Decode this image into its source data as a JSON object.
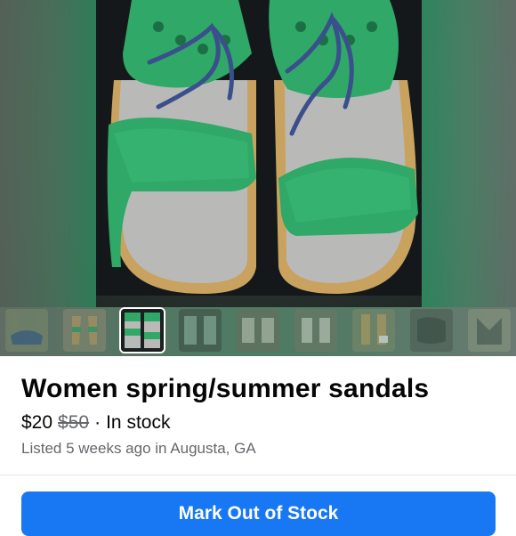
{
  "listing": {
    "title": "Women spring/summer sandals",
    "price": "$20",
    "original_price": "$50",
    "separator": "·",
    "stock_status": "In stock",
    "listed_info": "Listed 5 weeks ago in Augusta, GA"
  },
  "actions": {
    "primary_label": "Mark Out of Stock"
  },
  "gallery": {
    "image_count": 9,
    "selected_index": 2
  },
  "colors": {
    "accent": "#1877f2",
    "sandal_green": "#2fa868",
    "lace_blue": "#3a4f8c"
  }
}
